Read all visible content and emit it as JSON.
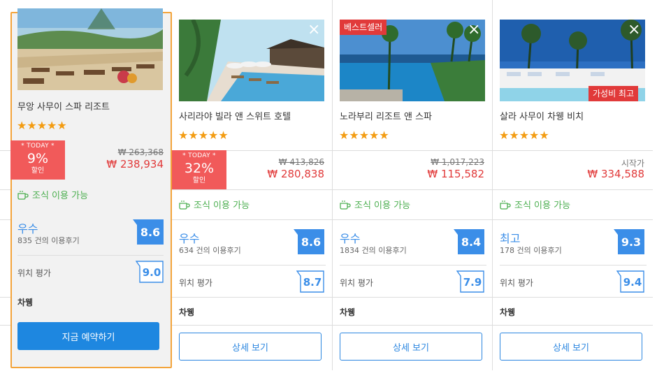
{
  "currency": "₩",
  "breakfast_label": "조식 이용 가능",
  "location_label": "위치 평가",
  "hotels": [
    {
      "name": "무앙 사무이 스파 리조트",
      "stars": "★★★★★",
      "today_label": "* TODAY *",
      "discount_pct": "9%",
      "discount_label": "할인",
      "price_original": "₩ 263,368",
      "price": "₩ 238,934",
      "rating_word": "우수",
      "reviews": "835 건의 이용후기",
      "score": "8.6",
      "location_score": "9.0",
      "room_type": "차웽",
      "button": "지금 예약하기"
    },
    {
      "name": "사리라야 빌라 앤 스위트 호텔",
      "stars": "★★★★★",
      "today_label": "* TODAY *",
      "discount_pct": "32%",
      "discount_label": "할인",
      "price_original": "₩ 413,826",
      "price": "₩ 280,838",
      "rating_word": "우수",
      "reviews": "634 건의 이용후기",
      "score": "8.6",
      "location_score": "8.7",
      "room_type": "차웽",
      "button": "상세 보기"
    },
    {
      "name": "노라부리 리조트 앤 스파",
      "stars": "★★★★★",
      "badge": "베스트셀러",
      "price_original": "₩ 1,017,223",
      "price": "₩ 115,582",
      "rating_word": "우수",
      "reviews": "1834 건의 이용후기",
      "score": "8.4",
      "location_score": "7.9",
      "room_type": "차웽",
      "button": "상세 보기"
    },
    {
      "name": "살라 사무이 차웽 비치",
      "stars": "★★★★★",
      "badge": "가성비 최고",
      "price_from": "시작가",
      "price": "₩ 334,588",
      "rating_word": "최고",
      "reviews": "178 건의 이용후기",
      "score": "9.3",
      "location_score": "9.4",
      "room_type": "차웽",
      "button": "상세 보기"
    }
  ],
  "colors": {
    "accent_blue": "#3b8ee8",
    "price_red": "#e13a3a",
    "deal_red": "#f15a5a",
    "star_orange": "#f39c12",
    "breakfast_green": "#4caf50",
    "featured_border": "#f3a43b"
  }
}
